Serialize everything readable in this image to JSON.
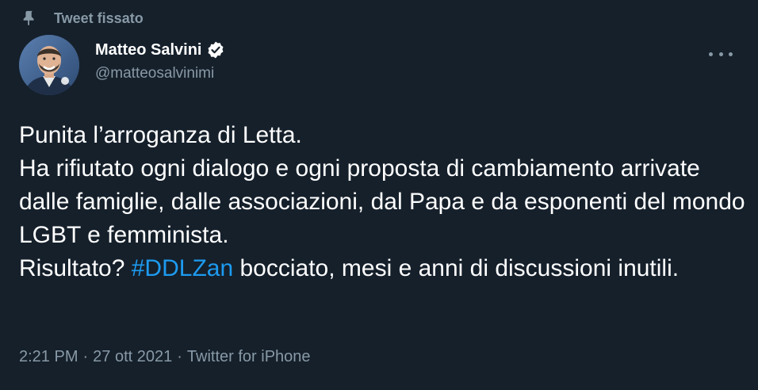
{
  "pinned": {
    "label": "Tweet fissato",
    "icon": "pin-icon"
  },
  "author": {
    "display_name": "Matteo Salvini",
    "handle": "@matteosalvinimi",
    "verified": true,
    "verified_icon": "verified-badge-icon",
    "avatar_icon": "avatar"
  },
  "more_icon": "more-icon",
  "tweet": {
    "line1": "Punita l’arroganza di Letta.",
    "line2a": "Ha rifiutato ogni dialogo e ogni proposta di cambiamento arrivate dalle famiglie, dalle associazioni, dal Papa e da esponenti del mondo LGBT e femminista.",
    "line3_prefix": "Risultato? ",
    "hashtag": "#DDLZan",
    "line3_suffix": " bocciato, mesi e anni di discussioni inutili."
  },
  "meta": {
    "time": "2:21 PM",
    "separator": "·",
    "date": "27 ott 2021",
    "source": "Twitter for iPhone"
  },
  "colors": {
    "background": "#15202b",
    "text": "#ffffff",
    "secondary": "#8899a6",
    "link": "#1d9bf0"
  }
}
